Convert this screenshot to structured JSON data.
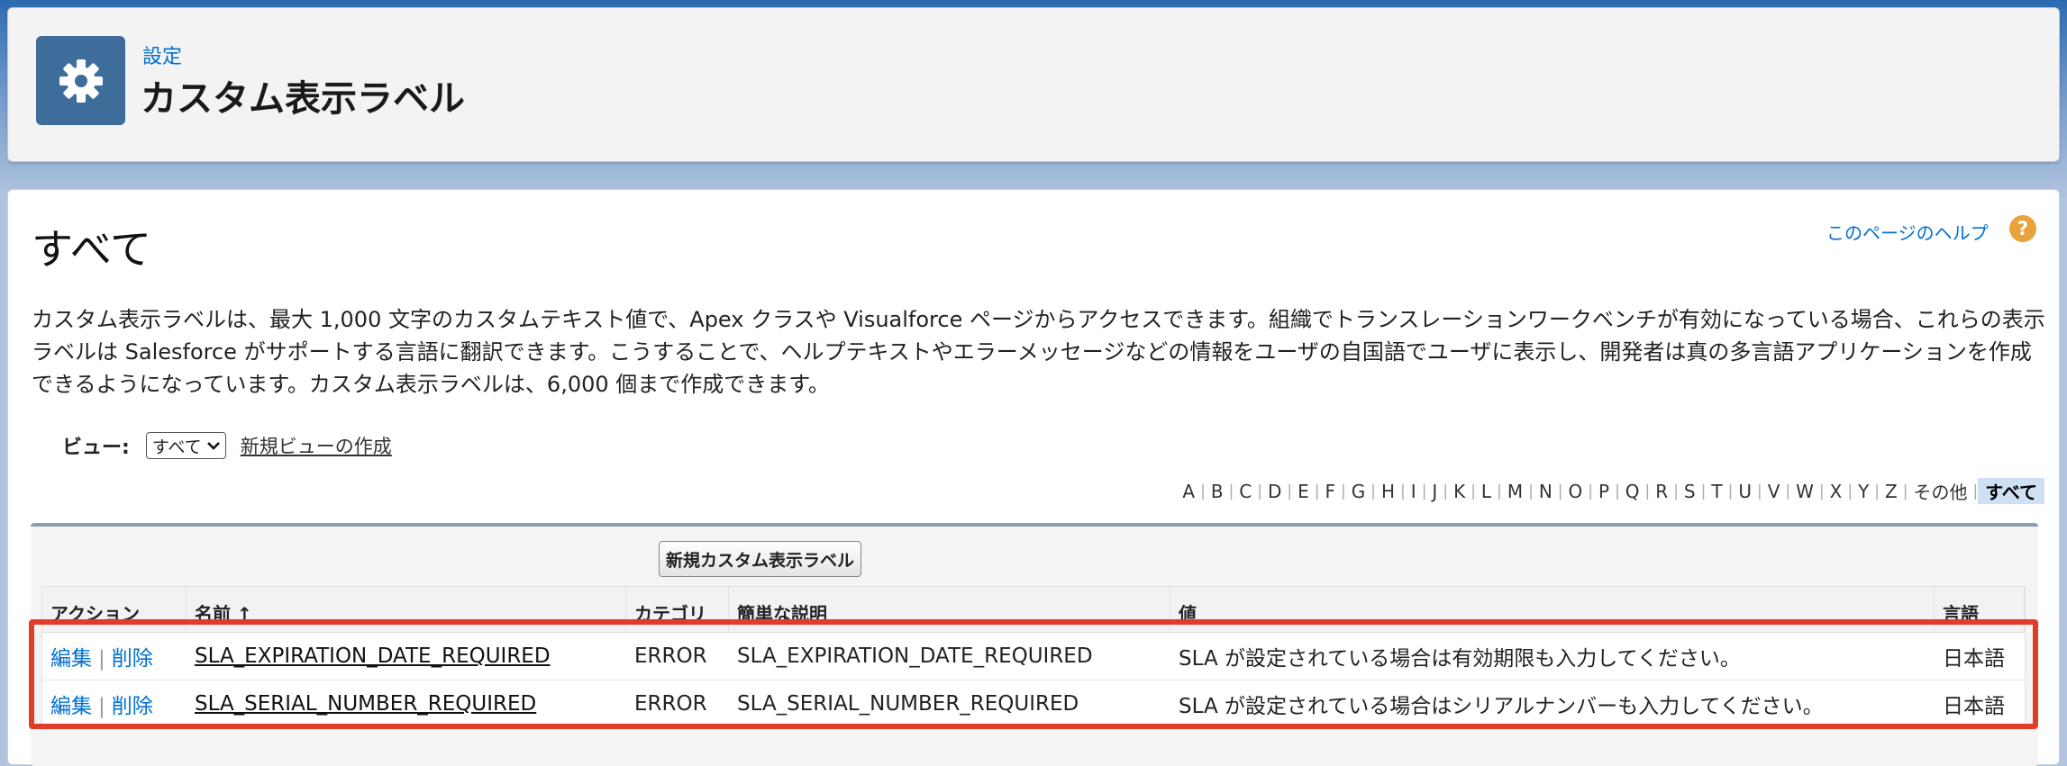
{
  "header": {
    "breadcrumb": "設定",
    "title": "カスタム表示ラベル",
    "icon": "gear-icon"
  },
  "main": {
    "heading": "すべて",
    "help_link": "このページのヘルプ",
    "description": "カスタム表示ラベルは、最大 1,000 文字のカスタムテキスト値で、Apex クラスや Visualforce ページからアクセスできます。組織でトランスレーションワークベンチが有効になっている場合、これらの表示ラベルは Salesforce がサポートする言語に翻訳できます。こうすることで、ヘルプテキストやエラーメッセージなどの情報をユーザの自国語でユーザに表示し、開発者は真の多言語アプリケーションを作成できるようになっています。カスタム表示ラベルは、6,000 個まで作成できます。"
  },
  "view": {
    "label": "ビュー:",
    "selected": "すべて",
    "new_view_link": "新規ビューの作成"
  },
  "alphabet": [
    "A",
    "B",
    "C",
    "D",
    "E",
    "F",
    "G",
    "H",
    "I",
    "J",
    "K",
    "L",
    "M",
    "N",
    "O",
    "P",
    "Q",
    "R",
    "S",
    "T",
    "U",
    "V",
    "W",
    "X",
    "Y",
    "Z",
    "その他",
    "すべて"
  ],
  "alphabet_active": "すべて",
  "list": {
    "new_button": "新規カスタム表示ラベル",
    "columns": [
      "アクション",
      "名前 ↑",
      "カテゴリ",
      "簡単な説明",
      "値",
      "言語"
    ],
    "action_edit": "編集",
    "action_delete": "削除",
    "action_separator": "|",
    "rows": [
      {
        "name": "SLA_EXPIRATION_DATE_REQUIRED",
        "category": "ERROR",
        "description": "SLA_EXPIRATION_DATE_REQUIRED",
        "value": "SLA が設定されている場合は有効期限も入力してください。",
        "language": "日本語"
      },
      {
        "name": "SLA_SERIAL_NUMBER_REQUIRED",
        "category": "ERROR",
        "description": "SLA_SERIAL_NUMBER_REQUIRED",
        "value": "SLA が設定されている場合はシリアルナンバーも入力してください。",
        "language": "日本語"
      }
    ]
  },
  "colors": {
    "accent": "#0070d2",
    "header_icon_bg": "#3e6d9c",
    "highlight_border": "#e23c29",
    "help_icon": "#e8a33d"
  }
}
